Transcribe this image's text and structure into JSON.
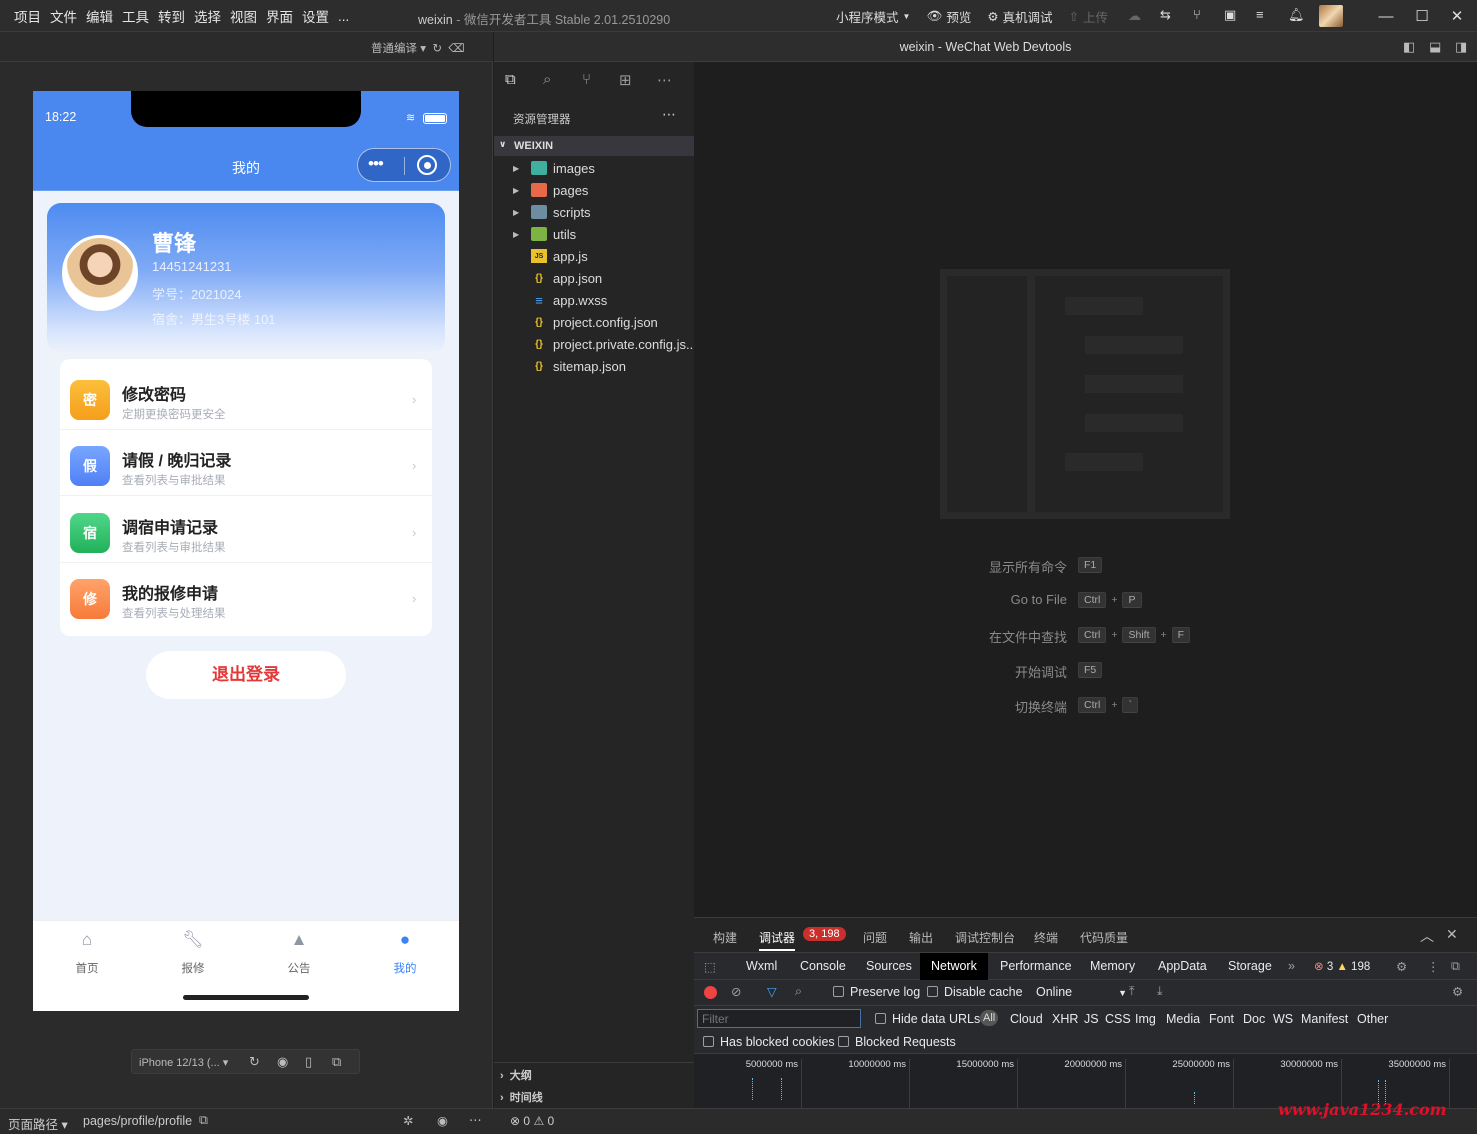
{
  "titlebar": {
    "menu": [
      "项目",
      "文件",
      "编辑",
      "工具",
      "转到",
      "选择",
      "视图",
      "界面",
      "设置",
      "..."
    ],
    "app_name": "weixin",
    "app_subtitle": " - 微信开发者工具 Stable 2.01.2510290",
    "mode": "小程序模式",
    "preview": "预览",
    "real_device": "真机调试",
    "upload": "上传"
  },
  "simulator": {
    "compile_mode": "普通编译",
    "status_time": "18:22",
    "nav_title": "我的",
    "profile": {
      "name": "曹锋",
      "phone": "14451241231",
      "student_no": "学号：2021024",
      "dorm": "宿舍：男生3号楼 101"
    },
    "menu_items": [
      {
        "badge": "密",
        "title": "修改密码",
        "subtitle": "定期更换密码更安全",
        "color": "#f5a623"
      },
      {
        "badge": "假",
        "title": "请假 / 晚归记录",
        "subtitle": "查看列表与审批结果",
        "color": "#5b8ff9"
      },
      {
        "badge": "宿",
        "title": "调宿申请记录",
        "subtitle": "查看列表与审批结果",
        "color": "#34c26b"
      },
      {
        "badge": "修",
        "title": "我的报修申请",
        "subtitle": "查看列表与处理结果",
        "color": "#f5884b"
      }
    ],
    "logout": "退出登录",
    "tabs": [
      {
        "label": "首页",
        "icon": "home-icon"
      },
      {
        "label": "报修",
        "icon": "wrench-icon"
      },
      {
        "label": "公告",
        "icon": "bell-icon"
      },
      {
        "label": "我的",
        "icon": "user-icon"
      }
    ],
    "active_tab_color": "#3b82f6",
    "device": "iPhone 12/13 (..."
  },
  "explorer": {
    "title": "资源管理器",
    "root": "WEIXIN",
    "items": [
      {
        "name": "images",
        "type": "folder",
        "icon_color": "#3fb0a0"
      },
      {
        "name": "pages",
        "type": "folder",
        "icon_color": "#e8684a"
      },
      {
        "name": "scripts",
        "type": "folder",
        "icon_color": "#6c8ea0"
      },
      {
        "name": "utils",
        "type": "folder",
        "icon_color": "#7cb342"
      },
      {
        "name": "app.js",
        "type": "js"
      },
      {
        "name": "app.json",
        "type": "json"
      },
      {
        "name": "app.wxss",
        "type": "css"
      },
      {
        "name": "project.config.json",
        "type": "json"
      },
      {
        "name": "project.private.config.js...",
        "type": "json"
      },
      {
        "name": "sitemap.json",
        "type": "json"
      }
    ],
    "outline": "大纲",
    "timeline": "时间线"
  },
  "editor": {
    "window_title": "weixin - WeChat Web Devtools",
    "shortcuts": [
      {
        "label": "显示所有命令",
        "keys": [
          "F1"
        ]
      },
      {
        "label": "Go to File",
        "keys": [
          "Ctrl",
          "P"
        ]
      },
      {
        "label": "在文件中查找",
        "keys": [
          "Ctrl",
          "Shift",
          "F"
        ]
      },
      {
        "label": "开始调试",
        "keys": [
          "F5"
        ]
      },
      {
        "label": "切换终端",
        "keys": [
          "Ctrl",
          "`"
        ]
      }
    ]
  },
  "devtools": {
    "tabs": [
      "构建",
      "调试器",
      "问题",
      "输出",
      "调试控制台",
      "终端",
      "代码质量"
    ],
    "debugger_badge": "3, 198",
    "subtabs": [
      "Wxml",
      "Console",
      "Sources",
      "Network",
      "Performance",
      "Memory",
      "AppData",
      "Storage"
    ],
    "active_subtab": "Network",
    "errors": "3",
    "warnings": "198",
    "preserve_log": "Preserve log",
    "disable_cache": "Disable cache",
    "throttle": "Online",
    "filter_placeholder": "Filter",
    "hide_data_urls": "Hide data URLs",
    "type_filters": [
      "All",
      "Cloud",
      "XHR",
      "JS",
      "CSS",
      "Img",
      "Media",
      "Font",
      "Doc",
      "WS",
      "Manifest",
      "Other"
    ],
    "has_blocked_cookies": "Has blocked cookies",
    "blocked_requests": "Blocked Requests",
    "timeline_ticks": [
      "5000000 ms",
      "10000000 ms",
      "15000000 ms",
      "20000000 ms",
      "25000000 ms",
      "30000000 ms",
      "35000000 ms"
    ]
  },
  "statusbar": {
    "page_path_label": "页面路径",
    "page_path": "pages/profile/profile",
    "errors": "0",
    "warnings": "0"
  },
  "watermark": "www.java1234.com"
}
